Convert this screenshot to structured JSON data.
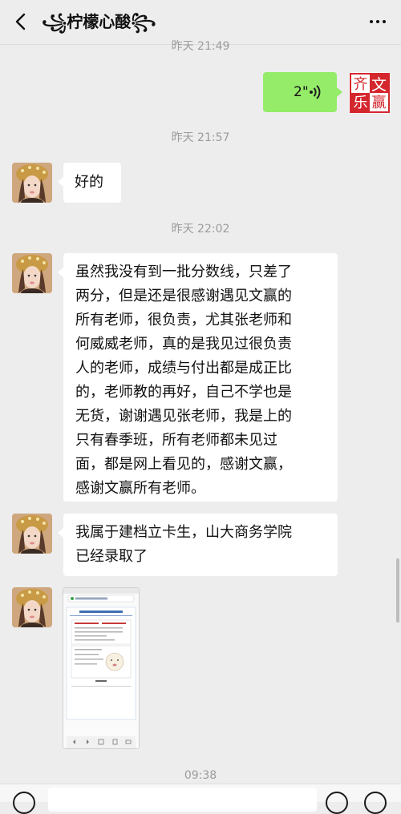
{
  "header": {
    "back_icon": "chevron-left-icon",
    "title": "꧁柠檬心酸꧂",
    "more_icon": "more-dots-icon"
  },
  "messages": {
    "ts0": "昨天 21:49",
    "voice": {
      "duration": "2\"",
      "icon": "voice-wave-icon"
    },
    "ts1": "昨天 21:57",
    "msg1": "好的",
    "ts2": "昨天 22:02",
    "msg2_lines": [
      "虽然我没有到一批分数线，只差了",
      "两分，但是还是很感谢遇见文赢的",
      "所有老师，很负责，尤其张老师和",
      "何威威老师，真的是我见过很负责",
      "人的老师，成绩与付出都是成正比",
      "的，老师教的再好，自己不学也是",
      "无货，谢谢遇见张老师，我是上的",
      "只有春季班，所有老师都未见过",
      "面，都是网上看见的，感谢文赢，",
      "感谢文赢所有老师。"
    ],
    "msg3_lines": [
      "我属于建档立卡生，山大商务学院",
      "已经录取了"
    ],
    "ts3": "09:38"
  },
  "seal": {
    "chars": [
      "文",
      "赢",
      "齐",
      "乐"
    ]
  },
  "colors": {
    "background": "#ededed",
    "self_bubble": "#95ec69",
    "seal_red": "#d4272d"
  }
}
